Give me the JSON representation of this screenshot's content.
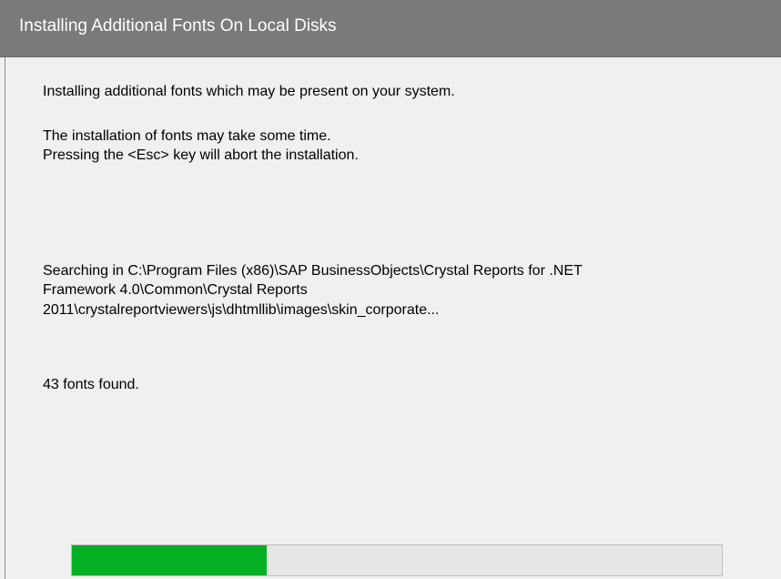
{
  "window": {
    "title": "Installing Additional Fonts On Local Disks"
  },
  "messages": {
    "intro": "Installing additional  fonts which may be present on your system.",
    "time_notice": "The installation of fonts may take some time.",
    "esc_notice": "Pressing the <Esc> key will abort the installation."
  },
  "search_status": {
    "line1": "Searching in C:\\Program Files (x86)\\SAP BusinessObjects\\Crystal Reports for .NET",
    "line2": "Framework 4.0\\Common\\Crystal Reports",
    "line3": "2011\\crystalreportviewers\\js\\dhtmllib\\images\\skin_corporate..."
  },
  "fonts_found": "43 fonts found.",
  "progress": {
    "fraction": 0.3,
    "fill_color": "#06b025",
    "track_color": "#e6e6e6"
  },
  "colors": {
    "titlebar": "#7a7a7a",
    "background": "#f0f0f0"
  }
}
